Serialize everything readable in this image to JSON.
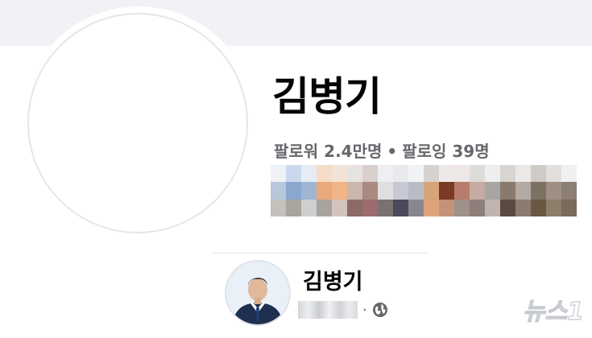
{
  "profile": {
    "name": "김병기",
    "followers_label": "팔로워",
    "followers_count": "2.4만명",
    "separator": "•",
    "following_label": "팔로잉",
    "following_count": "39명"
  },
  "post": {
    "author": "김병기",
    "meta_separator": "·",
    "audience_icon": "globe-icon"
  },
  "watermark": {
    "text": "뉴스1"
  },
  "colors": {
    "cover": "#f0f2f5",
    "name": "#050505",
    "secondary_text": "#65676b",
    "divider": "#e4e6eb"
  }
}
